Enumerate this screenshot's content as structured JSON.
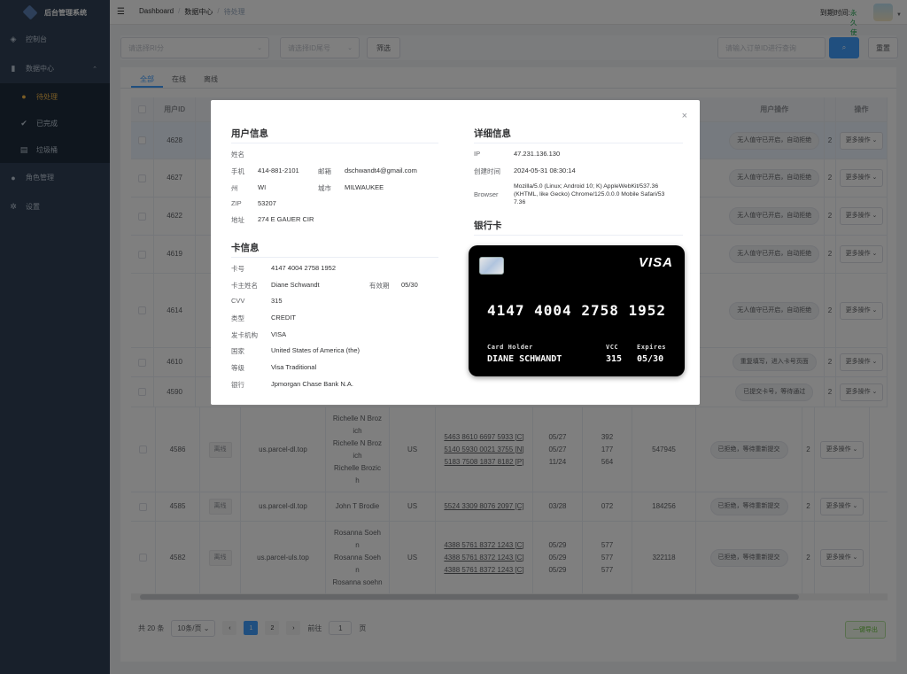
{
  "sidebar": {
    "app_title": "后台管理系统",
    "items": [
      {
        "label": "控制台",
        "icon": "dashboard-icon"
      },
      {
        "label": "数据中心",
        "icon": "chart-icon"
      },
      {
        "label": "待处理",
        "icon": "bell-icon"
      },
      {
        "label": "已完成",
        "icon": "check-circle-icon"
      },
      {
        "label": "垃圾桶",
        "icon": "trash-icon"
      },
      {
        "label": "角色管理",
        "icon": "user-icon"
      },
      {
        "label": "设置",
        "icon": "gear-icon"
      }
    ]
  },
  "topbar": {
    "breadcrumb": [
      "Dashboard",
      "数据中心",
      "待处理"
    ],
    "expire_label": "到期时间:",
    "expire_value": "永久使用"
  },
  "filters": {
    "select1_placeholder": "请选择RI分",
    "select2_placeholder": "请选择ID尾号",
    "filter_button": "筛选",
    "search_placeholder": "请输入订单ID进行查询",
    "reset_button": "重置"
  },
  "tabs": [
    "全部",
    "在线",
    "离线"
  ],
  "table": {
    "headers": {
      "user_id": "用户ID",
      "user_ops": "用户操作",
      "ops": "操作"
    },
    "rows": [
      {
        "id": "4628",
        "status": "无人值守已开启，自动拒绝",
        "op": "更多操作"
      },
      {
        "id": "4627",
        "status": "无人值守已开启，自动拒绝",
        "op": "更多操作"
      },
      {
        "id": "4622",
        "status": "无人值守已开启，自动拒绝",
        "op": "更多操作"
      },
      {
        "id": "4619",
        "status": "无人值守已开启，自动拒绝",
        "op": "更多操作"
      },
      {
        "id": "4614",
        "status": "无人值守已开启，自动拒绝",
        "op": "更多操作"
      },
      {
        "id": "4610",
        "status": "重复填写，进入卡号页面",
        "op": "更多操作"
      },
      {
        "id": "4590",
        "status": "已提交卡号，等待通过",
        "op": "更多操作"
      },
      {
        "id": "4586",
        "tag": "离线",
        "domain": "us.parcel-dl.top",
        "name_lines": [
          "Richelle N Broz",
          "ich",
          "Richelle N Broz",
          "ich",
          "Richelle Brozic",
          "h"
        ],
        "country": "US",
        "cards": [
          "5463 8610 6697 5933 [C]",
          "5140 5930 0021 3755 [N]",
          "5183 7508 1837 8182 [P]"
        ],
        "exps": [
          "05/27",
          "05/27",
          "11/24"
        ],
        "cvvs": [
          "392",
          "177",
          "564"
        ],
        "zip": "547945",
        "status": "已拒绝，等待重新提交",
        "col11": "2",
        "op": "更多操作"
      },
      {
        "id": "4585",
        "tag": "离线",
        "domain": "us.parcel-dl.top",
        "name_lines": [
          "John T Brodie"
        ],
        "country": "US",
        "cards": [
          "5524 3309 8076 2097 [C]"
        ],
        "exps": [
          "03/28"
        ],
        "cvvs": [
          "072"
        ],
        "zip": "184256",
        "status": "已拒绝，等待重新提交",
        "col11": "2",
        "op": "更多操作"
      },
      {
        "id": "4582",
        "tag": "离线",
        "domain": "us.parcel-uls.top",
        "name_lines": [
          "Rosanna Soeh",
          "n",
          "Rosanna Soeh",
          "n",
          "Rosanna soehn"
        ],
        "country": "US",
        "cards": [
          "4388 5761 8372 1243 [C]",
          "4388 5761 8372 1243 [C]",
          "4388 5761 8372 1243 [C]"
        ],
        "exps": [
          "05/29",
          "05/29",
          "05/29"
        ],
        "cvvs": [
          "577",
          "577",
          "577"
        ],
        "zip": "322118",
        "status": "已拒绝，等待重新提交",
        "col11": "2",
        "op": "更多操作"
      }
    ],
    "col11_partial": [
      "2",
      "2",
      "2",
      "2",
      "2",
      "2",
      "2"
    ]
  },
  "pagination": {
    "total": "共 20 条",
    "page_size": "10条/页",
    "pages": [
      "1",
      "2"
    ],
    "goto_label": "前往",
    "goto_value": "1",
    "page_suffix": "页",
    "export_button": "一键导出"
  },
  "modal": {
    "user_info_title": "用户信息",
    "name_label": "姓名",
    "name_value": "",
    "phone_label": "手机",
    "phone_value": "414-881-2101",
    "email_label": "邮箱",
    "email_value": "dschwandt4@gmail.com",
    "state_label": "州",
    "state_value": "WI",
    "city_label": "城市",
    "city_value": "MILWAUKEE",
    "zip_label": "ZIP",
    "zip_value": "53207",
    "address_label": "地址",
    "address_value": "274 E GAUER CIR",
    "card_info_title": "卡信息",
    "card_no_label": "卡号",
    "card_no_value": "4147 4004 2758 1952",
    "holder_label": "卡主姓名",
    "holder_value": "Diane Schwandt",
    "expiry_label": "有效期",
    "expiry_value": "05/30",
    "cvv_label": "CVV",
    "cvv_value": "315",
    "type_label": "类型",
    "type_value": "CREDIT",
    "issuer_label": "发卡机构",
    "issuer_value": "VISA",
    "country_label": "国家",
    "country_value": "United States of America (the)",
    "level_label": "等级",
    "level_value": "Visa Traditional",
    "bank_label": "银行",
    "bank_value": "Jpmorgan Chase Bank N.A.",
    "detail_title": "详细信息",
    "ip_label": "IP",
    "ip_value": "47.231.136.130",
    "created_label": "创建时间",
    "created_value": "2024-05-31 08:30:14",
    "browser_label": "Browser",
    "browser_lines": [
      "Mozilla/5.0 (Linux; Android 10; K) AppleWebKit/537.36",
      "(KHTML, like Gecko) Chrome/125.0.0.0 Mobile Safari/53",
      "7.36"
    ],
    "bank_card_title": "银行卡",
    "visual_card": {
      "brand": "VISA",
      "number": "4147 4004 2758 1952",
      "holder_label": "Card Holder",
      "holder": "DIANE SCHWANDT",
      "vcc_label": "VCC",
      "vcc": "315",
      "expires_label": "Expires",
      "expires": "05/30"
    }
  }
}
